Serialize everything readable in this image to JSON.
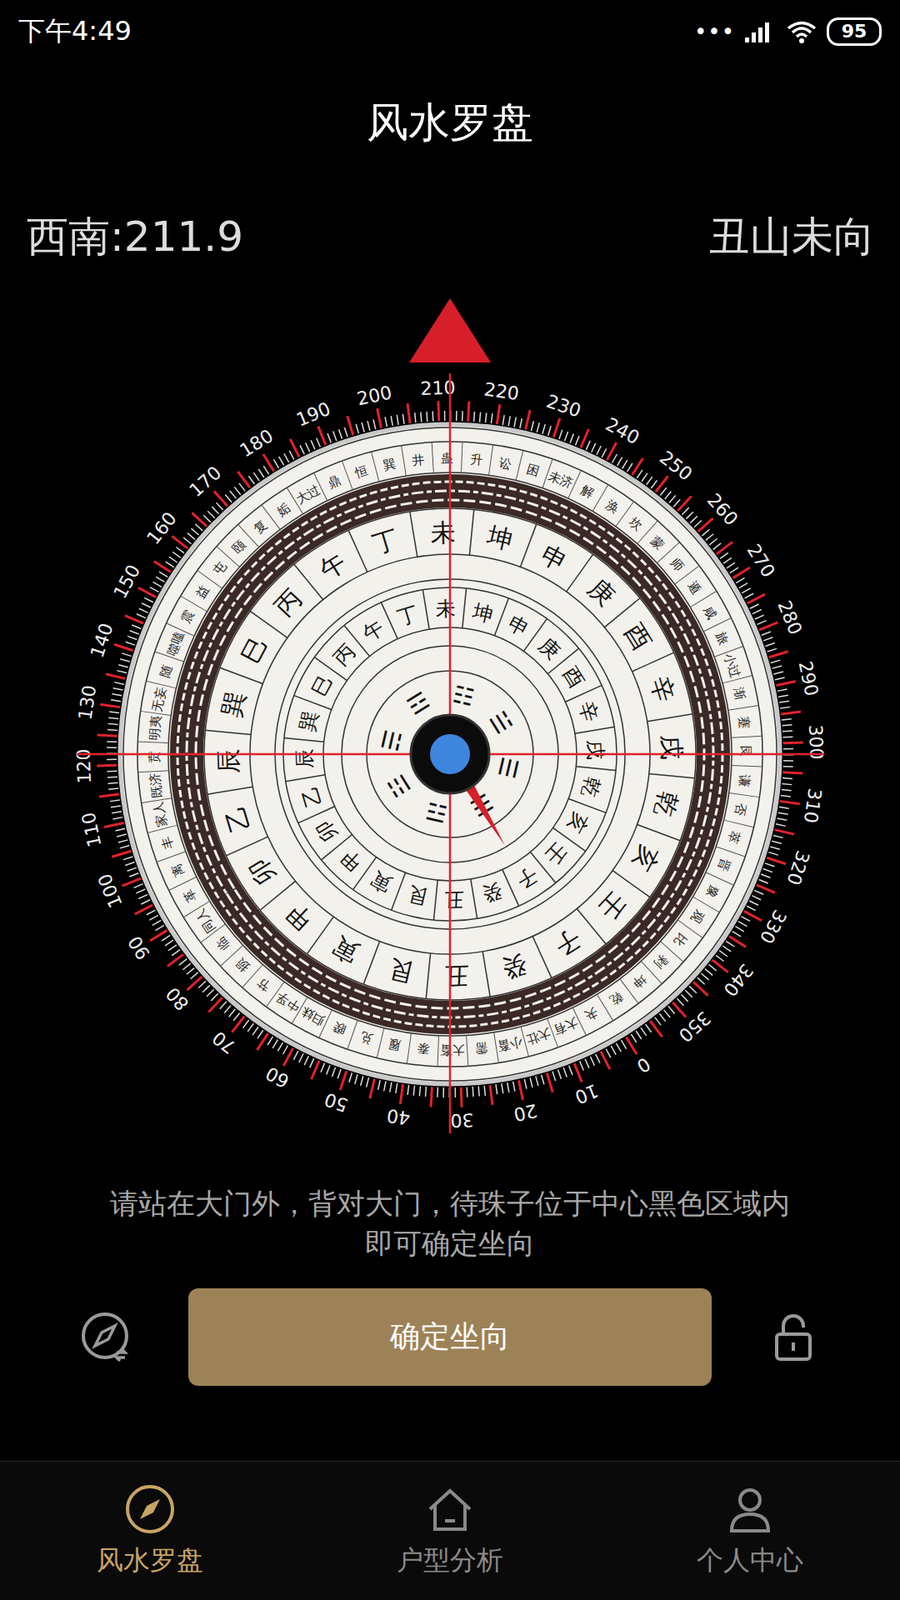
{
  "status_bar": {
    "time": "下午4:49",
    "dots": "•••",
    "battery": "95"
  },
  "title": "风水罗盘",
  "heading": {
    "direction": "西南:211.9",
    "mountain_facing": "丑山未向"
  },
  "compass": {
    "bearing_deg": 211.9,
    "needle_deg": 149,
    "degree_labels": [
      "0",
      "10",
      "20",
      "30",
      "40",
      "50",
      "60",
      "70",
      "80",
      "90",
      "100",
      "110",
      "120",
      "130",
      "140",
      "150",
      "160",
      "170",
      "180",
      "190",
      "200",
      "210",
      "220",
      "230",
      "240",
      "250",
      "260",
      "270",
      "280",
      "290",
      "300",
      "310",
      "320",
      "330",
      "340",
      "350"
    ],
    "mountains": [
      "子",
      "癸",
      "丑",
      "艮",
      "寅",
      "甲",
      "卯",
      "乙",
      "辰",
      "巽",
      "巳",
      "丙",
      "午",
      "丁",
      "未",
      "坤",
      "申",
      "庚",
      "酉",
      "辛",
      "戌",
      "乾",
      "亥",
      "壬"
    ],
    "trigrams": [
      "☵",
      "☶",
      "☳",
      "☴",
      "☲",
      "☷",
      "☱",
      "☰"
    ],
    "hexagrams": [
      "坤",
      "剥",
      "比",
      "观",
      "豫",
      "晋",
      "萃",
      "否",
      "谦",
      "艮",
      "蹇",
      "渐",
      "小过",
      "旅",
      "咸",
      "遁",
      "师",
      "蒙",
      "坎",
      "涣",
      "解",
      "未济",
      "困",
      "讼",
      "升",
      "蛊",
      "井",
      "巽",
      "恒",
      "鼎",
      "大过",
      "姤",
      "复",
      "颐",
      "屯",
      "益",
      "震",
      "噬嗑",
      "随",
      "无妄",
      "明夷",
      "贲",
      "既济",
      "家人",
      "丰",
      "离",
      "革",
      "同人",
      "临",
      "损",
      "节",
      "中孚",
      "归妹",
      "睽",
      "兑",
      "履",
      "泰",
      "大畜",
      "需",
      "小畜",
      "大壮",
      "大有",
      "夬",
      "乾"
    ]
  },
  "hint": "请站在大门外，背对大门，待珠子位于中心黑色区域内即可确定坐向",
  "confirm_button": "确定坐向",
  "lock": {
    "locked": false
  },
  "nav": [
    {
      "label": "风水罗盘",
      "selected": true
    },
    {
      "label": "户型分析",
      "selected": false
    },
    {
      "label": "个人中心",
      "selected": false
    }
  ]
}
